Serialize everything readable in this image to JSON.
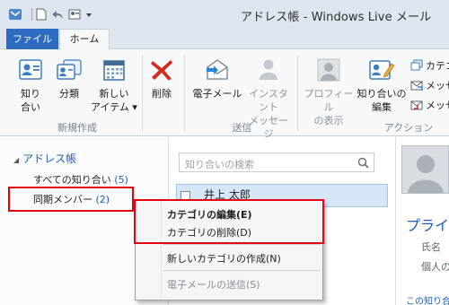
{
  "window": {
    "title": "アドレス帳 - Windows Live メール"
  },
  "tabs": [
    {
      "label": "ファイル",
      "active": false
    },
    {
      "label": "ホーム",
      "active": true
    }
  ],
  "ribbon": {
    "groups": [
      {
        "label": "新規作成",
        "buttons": [
          {
            "label": "知り\n合い",
            "icon": "contact-card-icon"
          },
          {
            "label": "分類",
            "icon": "category-cards-icon"
          },
          {
            "label": "新しい\nアイテム ▾",
            "icon": "calendar-icon"
          }
        ]
      },
      {
        "label": "",
        "buttons": [
          {
            "label": "削除",
            "icon": "delete-x-icon"
          }
        ]
      },
      {
        "label": "送信",
        "buttons": [
          {
            "label": "電子メール",
            "icon": "email-envelope-icon"
          },
          {
            "label": "インスタント\nメッセージ",
            "icon": "messenger-buddy-icon",
            "disabled": true
          }
        ]
      },
      {
        "label": "アクション",
        "buttons": [
          {
            "label": "プロフィール\nの表示",
            "icon": "profile-picture-icon",
            "disabled": true
          },
          {
            "label": "知り合いの\n編集",
            "icon": "edit-contact-icon"
          }
        ],
        "small_buttons": [
          {
            "label": "カテゴ",
            "icon": "category-small-icon"
          },
          {
            "label": "メッセ",
            "icon": "message-small-icon"
          },
          {
            "label": "メッセ",
            "icon": "message-small-icon"
          }
        ]
      }
    ]
  },
  "sidebar": {
    "root": "アドレス帳",
    "items": [
      {
        "label": "すべての知り合い",
        "count": "(5)"
      },
      {
        "label": "同期メンバー",
        "count": "(2)"
      }
    ]
  },
  "search": {
    "placeholder": "知り合いの検索"
  },
  "contacts": [
    {
      "name": "井上 太郎"
    }
  ],
  "details": {
    "heading": "プライ",
    "fields": [
      "氏名",
      "個人の"
    ],
    "link": "この知り合"
  },
  "context_menu": {
    "items": [
      {
        "label": "カテゴリの編集(E)",
        "bold": true
      },
      {
        "label": "カテゴリの削除(D)"
      },
      {
        "label": "新しいカテゴリの作成(N)"
      },
      {
        "label": "電子メールの送信(S)",
        "disabled": true
      }
    ]
  },
  "colors": {
    "highlight_box": "#e60012",
    "accent_blue": "#2d6cc0",
    "link_blue": "#1f5fb4"
  }
}
